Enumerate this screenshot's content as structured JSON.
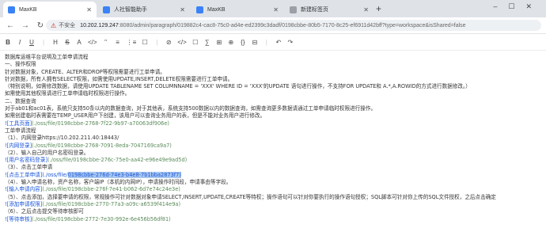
{
  "browser": {
    "tabs": [
      {
        "label": "MaxKB",
        "active": true,
        "color": "#3b82f6"
      },
      {
        "label": "人社智能助手",
        "active": false,
        "color": "#3b82f6"
      },
      {
        "label": "MaxKB",
        "active": false,
        "color": "#3b82f6"
      },
      {
        "label": "新建标签页",
        "active": false,
        "color": "#9aa0a6"
      }
    ],
    "security_label": "不安全",
    "url_host": "10.202.129.247",
    "url_rest": ":8080/admin/paragraph/019882c4-cac8-75c0-ad4e-ed2399c3dadf/0198cbbe-80b5-7170-8c25-ef6911d42bff?type=workspace&isShared=false"
  },
  "editor_toolbar": [
    "B",
    "I",
    "U",
    "H",
    "S",
    "A",
    "</>",
    "\"",
    "≡",
    "⋮≡",
    "☐",
    "⊘",
    "</>",
    "☐",
    "∑",
    "⊞",
    "⊕",
    "{}",
    "⊟",
    "↶",
    "↷"
  ],
  "document": {
    "lines": [
      {
        "parts": [
          {
            "t": "数据库运维平台说明及工单申请流程",
            "c": ""
          }
        ]
      },
      {
        "parts": [
          {
            "t": "一、操作权限",
            "c": ""
          }
        ]
      },
      {
        "parts": [
          {
            "t": "针对数据对象，CREATE、ALTER和DROP等权限需要进行工单申请。",
            "c": ""
          }
        ]
      },
      {
        "parts": [
          {
            "t": "针对数据，所有人拥有SELECT权限，如需使用UPDATE,INSERT,DELETE权限需要进行工单申请。",
            "c": ""
          }
        ]
      },
      {
        "parts": [
          {
            "t": "（特别说明，如需修改数据，请使用UPDATE TABLENAME SET COLUMNNAME = 'XXX' WHERE ID = 'XXX'的UPDATE 语句进行操作，不支持FOR UPDATE和 A.*,A.ROWID的方式进行数据修改。）",
            "c": ""
          }
        ]
      },
      {
        "parts": [
          {
            "t": "如需使用其他权限请进行工单申请临时权限进行操作。",
            "c": ""
          }
        ]
      },
      {
        "parts": [
          {
            "t": "二、数据查询",
            "c": ""
          }
        ]
      },
      {
        "parts": [
          {
            "t": "对于ab01和ac01表，系统只支持50条以内的数据查询，对于其他表，系统支持500数据以内的数据查询，如需查询更多数据请通过工单申请临时权限进行操作。",
            "c": ""
          }
        ]
      },
      {
        "parts": [
          {
            "t": "如需创建临时表需要在TEMP_USER用户下创建，该用户可以查询业务用户的表，但是不能对业务用户进行修改。",
            "c": ""
          }
        ]
      },
      {
        "parts": [
          {
            "t": "![工具页面]",
            "c": "lk"
          },
          {
            "t": "(./oss/file/0198cbbe-2768-7f22-9b97-a70063df906e)",
            "c": "lp"
          }
        ]
      },
      {
        "parts": [
          {
            "t": "工单申请流程",
            "c": ""
          }
        ]
      },
      {
        "parts": [
          {
            "t": "（1）、内网登录https://10.202.211.40:18443/",
            "c": ""
          }
        ]
      },
      {
        "parts": [
          {
            "t": "![内网登录]",
            "c": "lk"
          },
          {
            "t": "(./oss/file/0198cbbe-2768-7091-8eda-7047169ca9a7)",
            "c": "lp"
          }
        ]
      },
      {
        "parts": [
          {
            "t": "（2）、输入自己的用户名密码登录。",
            "c": ""
          }
        ]
      },
      {
        "parts": [
          {
            "t": "![用户名密码登录]",
            "c": "lk"
          },
          {
            "t": "(./oss/file/0198cbbe-276c-75e0-aa42-e96e49e9ad5d)",
            "c": "lp"
          }
        ]
      },
      {
        "parts": [
          {
            "t": "（3）、点击工单申请",
            "c": ""
          }
        ]
      },
      {
        "parts": [
          {
            "t": "![点击工单申请](./oss/file/",
            "c": "lb"
          },
          {
            "t": "0198cbbe-276d-74e3-b4e8-7b1bba2873f7)",
            "c": "hl"
          }
        ]
      },
      {
        "parts": [
          {
            "t": "（4）、输入申请名称，资产名称，客户端IP（本机的内网IP），申请操作时间段，申请事由等字段。",
            "c": ""
          }
        ]
      },
      {
        "parts": [
          {
            "t": "![输入申请内容]",
            "c": "lk"
          },
          {
            "t": "(./oss/file/0198cbbe-276f-7e41-b062-6d7e74c24e3e)",
            "c": "lp"
          }
        ]
      },
      {
        "parts": [
          {
            "t": "（5）、点击添加，选择要申请的权限，常规操作可针对数据对象申请SELECT,INSERT,UPDATE,CREATE等特权；操作语句可以针对你要执行的操作语句授权；SQL脚本可针对你上传的SQL文件授权，之后点击确定",
            "c": ""
          }
        ]
      },
      {
        "parts": [
          {
            "t": "![添加申请权限]",
            "c": "lk"
          },
          {
            "t": "(./oss/file/0198cbbe-2770-77a3-a09c-a6539f414e9a)",
            "c": "lp"
          }
        ]
      },
      {
        "parts": [
          {
            "t": "（6）、之后点击提交等待审核即可",
            "c": ""
          }
        ]
      },
      {
        "parts": [
          {
            "t": "![等待审核]",
            "c": "lk"
          },
          {
            "t": "(./oss/file/0198cbbe-2772-7e30-992e-6e456b56df81)",
            "c": "lp"
          }
        ]
      }
    ]
  }
}
